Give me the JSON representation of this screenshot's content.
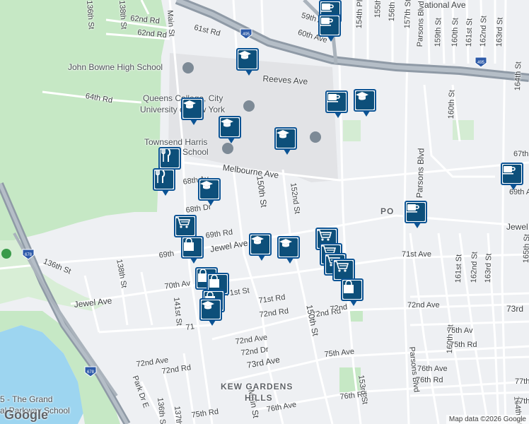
{
  "streets": {
    "main_st_a": "Main St",
    "main_st_b": "Main St",
    "s136_a": "136th St",
    "s138": "138th St",
    "s62rd_a": "62nd Rd",
    "s62rd_b": "62nd Rd",
    "s61rd": "61st Rd",
    "s60av": "60th Ave",
    "s59av": "59th A",
    "s154pl": "154th Pl",
    "s155": "155th St",
    "s156": "156th St",
    "s157": "157th St",
    "parsons_a": "Parsons Blvd",
    "s159": "159th St",
    "s160": "160th St",
    "s161": "161st St",
    "s162": "162nd St",
    "s163": "163rd St",
    "national": "ational Ave",
    "reeves": "Reeves Ave",
    "s64rd": "64th Rd",
    "melbourne": "Melbourne Ave",
    "s68av": "68th Av",
    "s68dr": "68th Dr",
    "s150_a": "150th St",
    "s152": "152nd St",
    "s69rd": "69th Rd",
    "s69av": "69th",
    "jewel_a": "Jewel Ave",
    "jewel_b": "Jewel Ave",
    "jewel_c": "Jewel",
    "s136_b": "136th St",
    "s70av": "70th Av",
    "s141": "141st St",
    "s71rd": "71st Rd",
    "s71st": "71st St",
    "s71av_a": "71st Ave",
    "s72dr": "72nd Dr",
    "s72rd_a": "72nd Rd",
    "s72rd_b": "72nd Rd",
    "s72av_a": "72nd Ave",
    "s72av_b": "72nd Ave",
    "s72av_c": "72nd Ave",
    "s73av_a": "73rd Ave",
    "s73av_b": "73rd",
    "s150_b": "150th St",
    "parsons_b": "Parsons Blvd",
    "s164_a": "164th St",
    "s164_b": "164th St",
    "s160_b": "160th St",
    "s162_b": "162nd St",
    "s163_b": "163rd St",
    "s165": "165th St",
    "s67av": "67th",
    "s69av_b": "69th Av",
    "s75av": "75th Av",
    "s75rd": "75th Rd",
    "s75av_b": "75th Ave",
    "s76av": "76th Ave",
    "s76rd": "76th Rd",
    "s76rd_b": "76th Rd",
    "s76av_b": "76th Ave",
    "s75rd_b": "75th Rd",
    "s77": "77th",
    "s77b": "77th",
    "s153": "153rd St",
    "s136_c": "136th St",
    "s137": "137th",
    "park_dr": "Park Dr E",
    "s160_c": "160th St",
    "s164_c": "164th St",
    "s161_b": "161st St",
    "s71rd_b": "71st Rd",
    "s72dr_b": "72nd Dr",
    "s70_b": "70",
    "s71_b": "71",
    "s72nd": "72nd",
    "s73b": "73",
    "s64rd_b": "64th Rd"
  },
  "areas": {
    "kew_gardens_1": "KEW GARDENS",
    "kew_gardens_2": "HILLS",
    "pomonok": "PO"
  },
  "pois": {
    "john_bowne": "John Bowne High School",
    "queens_college_1": "Queens College, City",
    "queens_college_2": "University of New York",
    "townsend_1": "Townsend Harris",
    "townsend_2": "High School",
    "grand_central_1": "5 - The Grand",
    "grand_central_2": "al Parkway School"
  },
  "highways": {
    "i495_a": "495",
    "i495_b": "495",
    "i678_a": "678",
    "i678_b": "678"
  },
  "colors": {
    "land": "#eef0f3",
    "park": "#c6e8c5",
    "water": "#9dd5f0",
    "campus": "#e2e3e6",
    "highway": "#8f9aa6",
    "pin_fill": "#0d4f7a",
    "pin_border": "#0b5394"
  },
  "markers": [
    {
      "type": "cafe-icon"
    },
    {
      "type": "cafe-icon"
    },
    {
      "type": "school-icon"
    },
    {
      "type": "cafe-icon"
    },
    {
      "type": "school-icon"
    },
    {
      "type": "school-icon"
    },
    {
      "type": "school-icon"
    },
    {
      "type": "school-icon"
    },
    {
      "type": "restaurant-icon"
    },
    {
      "type": "restaurant-icon"
    },
    {
      "type": "school-icon"
    },
    {
      "type": "cafe-icon"
    },
    {
      "type": "cafe-icon"
    },
    {
      "type": "shopping-cart-icon"
    },
    {
      "type": "shopping-bag-icon"
    },
    {
      "type": "school-icon"
    },
    {
      "type": "school-icon"
    },
    {
      "type": "shopping-cart-icon"
    },
    {
      "type": "shopping-cart-icon"
    },
    {
      "type": "shopping-cart-icon"
    },
    {
      "type": "shopping-cart-icon"
    },
    {
      "type": "shopping-bag-icon"
    },
    {
      "type": "shopping-bag-icon"
    },
    {
      "type": "shopping-bag-icon"
    },
    {
      "type": "school-icon"
    },
    {
      "type": "shopping-bag-icon"
    }
  ],
  "attribution": "Map data ©2026 Google",
  "logo": "Google"
}
